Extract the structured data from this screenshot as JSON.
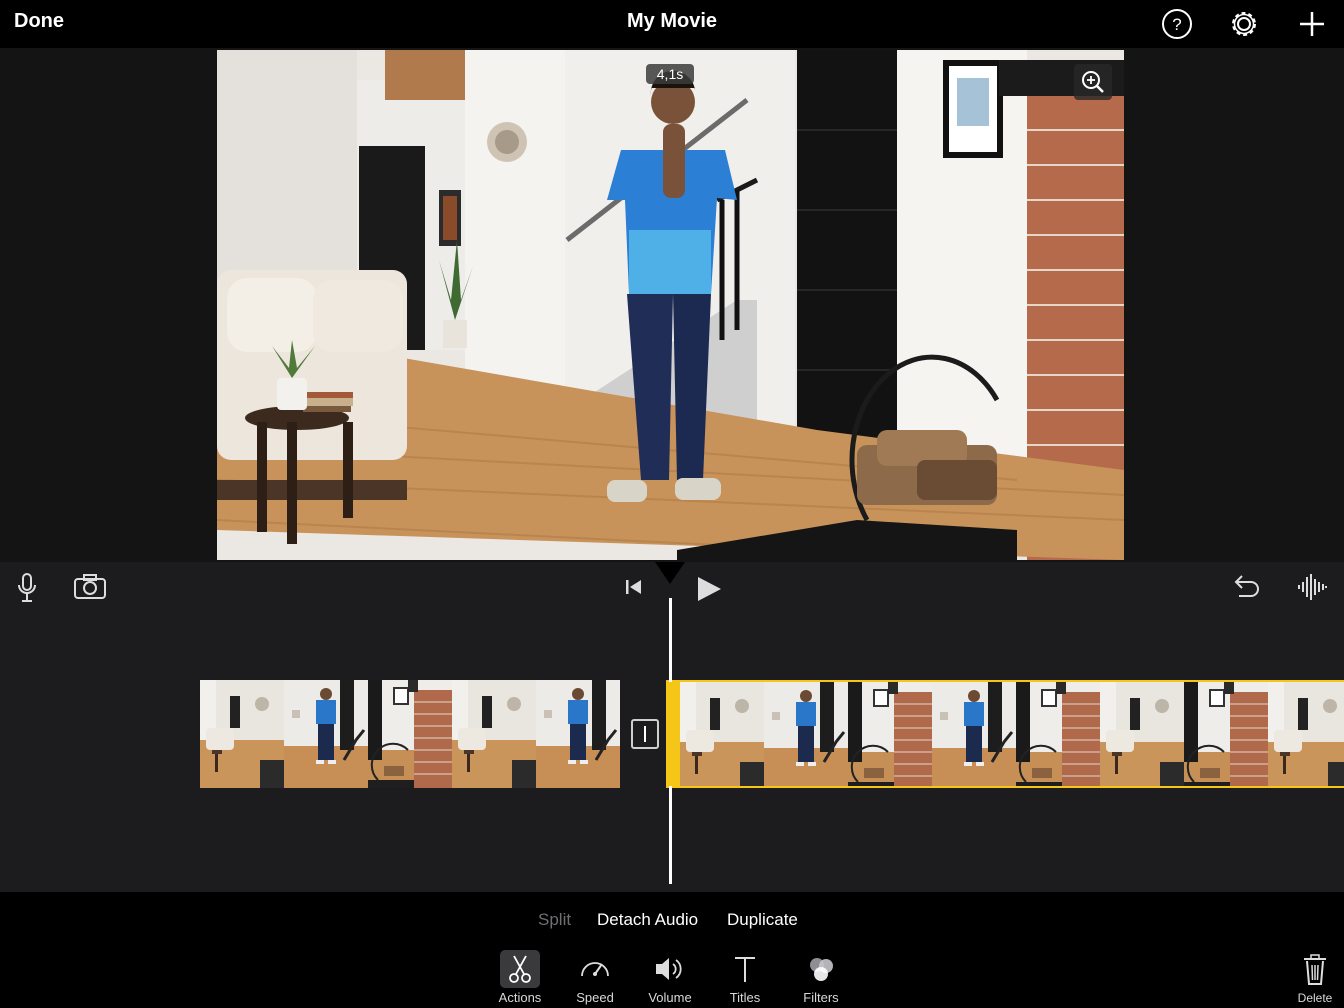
{
  "header": {
    "done_label": "Done",
    "title": "My Movie",
    "icons": [
      "help-icon",
      "settings-gear-icon",
      "add-plus-icon"
    ]
  },
  "viewer": {
    "duration_badge": "4,1s",
    "zoom_icon": "zoom-in-icon"
  },
  "timeline": {
    "left_icons": [
      "microphone-icon",
      "camera-icon"
    ],
    "center_icons": [
      "skip-to-start-icon",
      "play-icon"
    ],
    "right_icons": [
      "undo-icon",
      "audio-waveform-icon"
    ]
  },
  "actions": {
    "split": "Split",
    "detach_audio": "Detach Audio",
    "duplicate": "Duplicate"
  },
  "toolbar": [
    {
      "label": "Actions",
      "icon": "scissors-icon",
      "selected": true
    },
    {
      "label": "Speed",
      "icon": "speedometer-icon",
      "selected": false
    },
    {
      "label": "Volume",
      "icon": "speaker-icon",
      "selected": false
    },
    {
      "label": "Titles",
      "icon": "text-t-icon",
      "selected": false
    },
    {
      "label": "Filters",
      "icon": "filter-circles-icon",
      "selected": false
    }
  ],
  "delete_label": "Delete",
  "colors": {
    "selection_accent": "#f5c518",
    "timeline_bg": "#1c1c1e",
    "disabled_text": "#6e6e73"
  }
}
